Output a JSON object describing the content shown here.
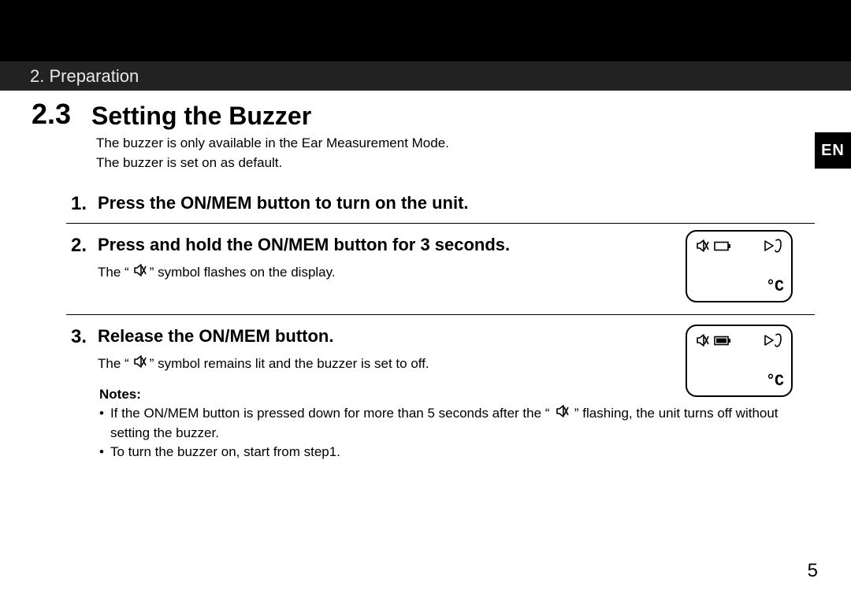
{
  "chapter": {
    "title": "2. Preparation"
  },
  "section": {
    "number": "2.3",
    "title": "Setting the Buzzer"
  },
  "intro": {
    "line1": "The buzzer is only available in the Ear Measurement Mode.",
    "line2": "The buzzer is set on as default."
  },
  "steps": [
    {
      "num": "1.",
      "title": "Press the ON/MEM button to turn on the unit."
    },
    {
      "num": "2.",
      "title": "Press and hold the ON/MEM button for 3 seconds.",
      "desc_pre": "The “",
      "desc_post": "” symbol flashes on the display."
    },
    {
      "num": "3.",
      "title": "Release the ON/MEM button.",
      "desc_pre": "The “",
      "desc_post": "” symbol remains lit and the buzzer is set to off."
    }
  ],
  "notes": {
    "label": "Notes:",
    "items": [
      {
        "pre": "If the ON/MEM button is pressed down for more than 5 seconds after the “",
        "post": "” flashing, the unit turns off without setting the buzzer."
      },
      {
        "text": "To turn the buzzer on, start from step1."
      }
    ]
  },
  "language_tab": "EN",
  "page_number": "5",
  "display": {
    "unit": "°C"
  },
  "icons": {
    "mute": "mute-icon",
    "battery_empty": "battery-empty-icon",
    "battery_full": "battery-full-icon",
    "triangle": "play-triangle-icon",
    "ear": "ear-icon"
  }
}
